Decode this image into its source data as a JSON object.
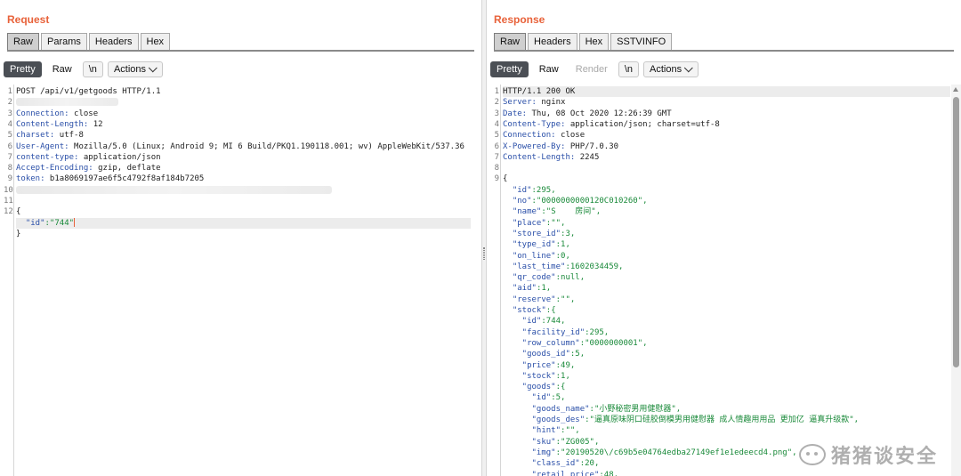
{
  "request": {
    "title": "Request",
    "tabs": [
      {
        "label": "Raw",
        "active": true
      },
      {
        "label": "Params",
        "active": false
      },
      {
        "label": "Headers",
        "active": false
      },
      {
        "label": "Hex",
        "active": false
      }
    ],
    "toolbar": {
      "pretty": "Pretty",
      "raw": "Raw",
      "newline": "\\n",
      "actions": "Actions"
    },
    "lines": [
      {
        "n": "1",
        "text": "POST /api/v1/getgoods HTTP/1.1"
      },
      {
        "n": "2",
        "text": ""
      },
      {
        "n": "3",
        "key": "Connection:",
        "value": " close"
      },
      {
        "n": "4",
        "key": "Content-Length:",
        "value": " 12"
      },
      {
        "n": "5",
        "key": "charset:",
        "value": " utf-8"
      },
      {
        "n": "6",
        "key": "User-Agent:",
        "value": " Mozilla/5.0 (Linux; Android 9; MI 6 Build/PKQ1.190118.001; wv) AppleWebKit/537.36 (KHTML, lik"
      },
      {
        "n": "7",
        "key": "content-type:",
        "value": " application/json"
      },
      {
        "n": "8",
        "key": "Accept-Encoding:",
        "value": " gzip, deflate"
      },
      {
        "n": "9",
        "key": "token:",
        "value": " b1a8069197ae6f5c4792f8af184b7205"
      },
      {
        "n": "10",
        "text": ""
      },
      {
        "n": "11",
        "text": ""
      },
      {
        "n": "12",
        "text": "{"
      },
      {
        "n": "",
        "key": "  \"id\"",
        "value": ":\"744\""
      },
      {
        "n": "",
        "text": "}"
      }
    ]
  },
  "response": {
    "title": "Response",
    "tabs": [
      {
        "label": "Raw",
        "active": true
      },
      {
        "label": "Headers",
        "active": false
      },
      {
        "label": "Hex",
        "active": false
      },
      {
        "label": "SSTVINFO",
        "active": false
      }
    ],
    "toolbar": {
      "pretty": "Pretty",
      "raw": "Raw",
      "render": "Render",
      "newline": "\\n",
      "actions": "Actions"
    },
    "lines": [
      {
        "n": "1",
        "text": "HTTP/1.1 200 OK"
      },
      {
        "n": "2",
        "key": "Server:",
        "value": " nginx"
      },
      {
        "n": "3",
        "key": "Date:",
        "value": " Thu, 08 Oct 2020 12:26:39 GMT"
      },
      {
        "n": "4",
        "key": "Content-Type:",
        "value": " application/json; charset=utf-8"
      },
      {
        "n": "5",
        "key": "Connection:",
        "value": " close"
      },
      {
        "n": "6",
        "key": "X-Powered-By:",
        "value": " PHP/7.0.30"
      },
      {
        "n": "7",
        "key": "Content-Length:",
        "value": " 2245"
      },
      {
        "n": "8",
        "text": ""
      },
      {
        "n": "9",
        "text": "{"
      },
      {
        "n": "",
        "key": "  \"id\"",
        "value": ":295,"
      },
      {
        "n": "",
        "key": "  \"no\"",
        "value": ":\"0000000000120C010260\","
      },
      {
        "n": "",
        "key": "  \"name\"",
        "value": ":\"S    房间\","
      },
      {
        "n": "",
        "key": "  \"place\"",
        "value": ":\"\","
      },
      {
        "n": "",
        "key": "  \"store_id\"",
        "value": ":3,"
      },
      {
        "n": "",
        "key": "  \"type_id\"",
        "value": ":1,"
      },
      {
        "n": "",
        "key": "  \"on_line\"",
        "value": ":0,"
      },
      {
        "n": "",
        "key": "  \"last_time\"",
        "value": ":1602034459,"
      },
      {
        "n": "",
        "key": "  \"qr_code\"",
        "value": ":null,"
      },
      {
        "n": "",
        "key": "  \"aid\"",
        "value": ":1,"
      },
      {
        "n": "",
        "key": "  \"reserve\"",
        "value": ":\"\","
      },
      {
        "n": "",
        "key": "  \"stock\"",
        "value": ":{"
      },
      {
        "n": "",
        "key": "    \"id\"",
        "value": ":744,"
      },
      {
        "n": "",
        "key": "    \"facility_id\"",
        "value": ":295,"
      },
      {
        "n": "",
        "key": "    \"row_column\"",
        "value": ":\"0000000001\","
      },
      {
        "n": "",
        "key": "    \"goods_id\"",
        "value": ":5,"
      },
      {
        "n": "",
        "key": "    \"price\"",
        "value": ":49,"
      },
      {
        "n": "",
        "key": "    \"stock\"",
        "value": ":1,"
      },
      {
        "n": "",
        "key": "    \"goods\"",
        "value": ":{"
      },
      {
        "n": "",
        "key": "      \"id\"",
        "value": ":5,"
      },
      {
        "n": "",
        "key": "      \"goods_name\"",
        "value": ":\"小野秘密男用健慰器\","
      },
      {
        "n": "",
        "key": "      \"goods_des\"",
        "value": ":\"逼真原味阴口硅胶倒模男用健慰器 成人情趣用用品 更加亿 逼真升级款\","
      },
      {
        "n": "",
        "key": "      \"hint\"",
        "value": ":\"\","
      },
      {
        "n": "",
        "key": "      \"sku\"",
        "value": ":\"ZG005\","
      },
      {
        "n": "",
        "key": "      \"img\"",
        "value": ":\"20190520\\/c69b5e04764edba27149ef1e1edeecd4.png\","
      },
      {
        "n": "",
        "key": "      \"class_id\"",
        "value": ":20,"
      },
      {
        "n": "",
        "key": "      \"retail_price\"",
        "value": ":48,"
      }
    ]
  },
  "watermark": {
    "text": "猪猪谈安全"
  }
}
